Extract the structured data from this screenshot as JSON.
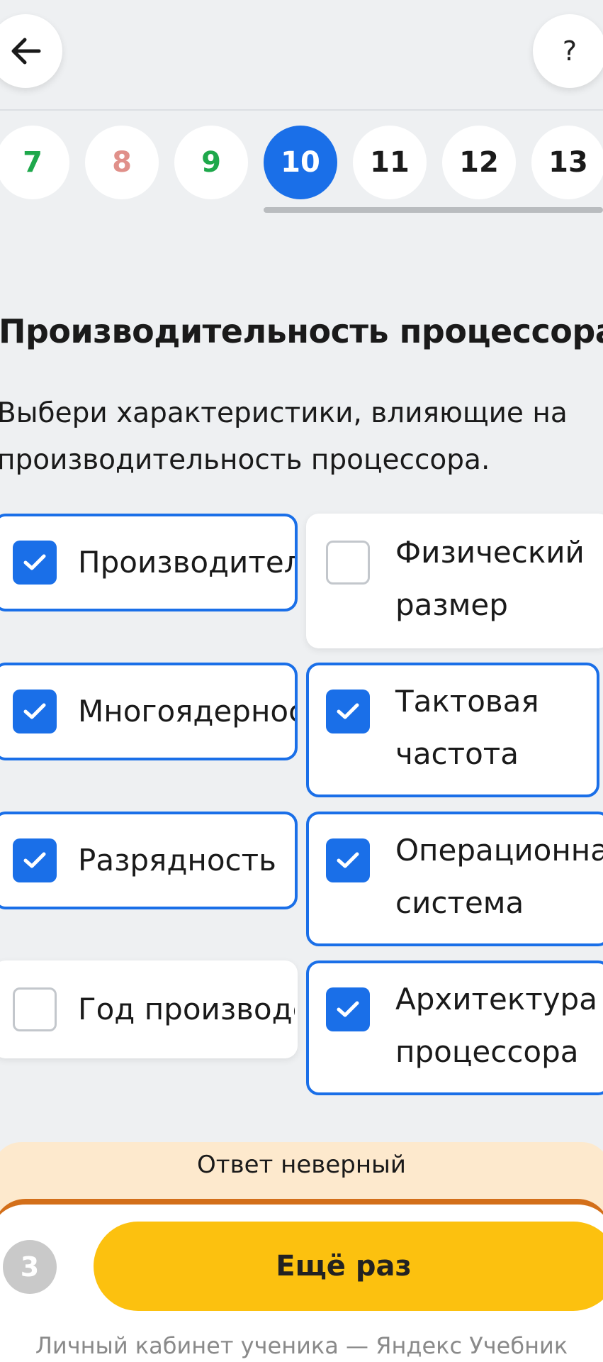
{
  "header": {
    "back_icon": "arrow-left-icon",
    "help_label": "?"
  },
  "pager": {
    "items": [
      {
        "label": "7",
        "state": "correct"
      },
      {
        "label": "8",
        "state": "wrong"
      },
      {
        "label": "9",
        "state": "correct"
      },
      {
        "label": "10",
        "state": "current"
      },
      {
        "label": "11",
        "state": "default"
      },
      {
        "label": "12",
        "state": "default"
      },
      {
        "label": "13",
        "state": "default"
      }
    ]
  },
  "task": {
    "title": "Производительность процессора",
    "description": "Выбери характеристики, влияющие на производительность процессора."
  },
  "options": [
    {
      "label": "Производительность",
      "checked": true
    },
    {
      "label": "Физический размер",
      "checked": false
    },
    {
      "label": "Многоядерность",
      "checked": true
    },
    {
      "label": "Тактовая частота",
      "checked": true
    },
    {
      "label": "Разрядность",
      "checked": true
    },
    {
      "label": "Операционная система",
      "checked": true
    },
    {
      "label": "Год производства",
      "checked": false
    },
    {
      "label": "Архитектура процессора",
      "checked": true
    }
  ],
  "result": {
    "message": "Ответ неверный",
    "attempts": "3",
    "retry_label": "Ещё раз"
  },
  "footer": {
    "text": "Личный кабинет ученика — Яндекс Учебник"
  },
  "colors": {
    "accent": "#1a6fe8",
    "correct": "#1ea84b",
    "wrong": "#e0908a",
    "retry_button": "#fcc10f",
    "feedback_bg": "#fde9cd",
    "feedback_border": "#d36f1a"
  }
}
